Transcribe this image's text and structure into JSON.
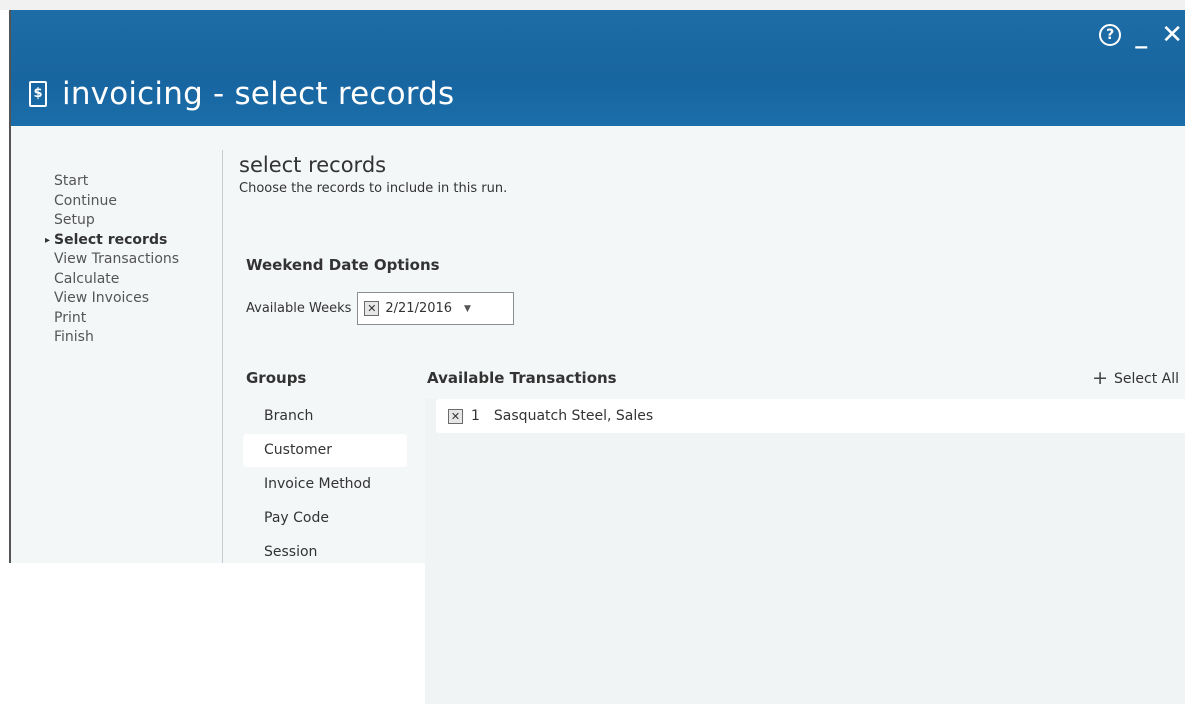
{
  "window": {
    "title": "invoicing - select records",
    "title_icon": "$",
    "controls": {
      "help": "?",
      "minimize": "_",
      "close": "✕"
    }
  },
  "nav": {
    "items": [
      {
        "label": "Start"
      },
      {
        "label": "Continue"
      },
      {
        "label": "Setup"
      },
      {
        "label": "Select records",
        "active": true
      },
      {
        "label": "View Transactions"
      },
      {
        "label": "Calculate"
      },
      {
        "label": "View Invoices"
      },
      {
        "label": "Print"
      },
      {
        "label": "Finish"
      }
    ]
  },
  "main": {
    "title": "select records",
    "subtitle": "Choose the records to include in this run.",
    "weekend_section": {
      "title": "Weekend Date Options",
      "available_weeks_label": "Available Weeks",
      "selected_week": "2/21/2016",
      "remove_glyph": "✕"
    },
    "groups": {
      "title": "Groups",
      "items": [
        "Branch",
        "Customer",
        "Invoice Method",
        "Pay Code",
        "Session"
      ],
      "selected": "Customer"
    },
    "available_transactions": {
      "title": "Available Transactions",
      "select_all_label": "Select All",
      "select_all_icon": "+",
      "rows": [
        {
          "count": "1",
          "name": "Sasquatch Steel, Sales"
        }
      ]
    }
  },
  "colors": {
    "header_bg": "#1865a0",
    "body_bg": "#f4f7f8"
  }
}
